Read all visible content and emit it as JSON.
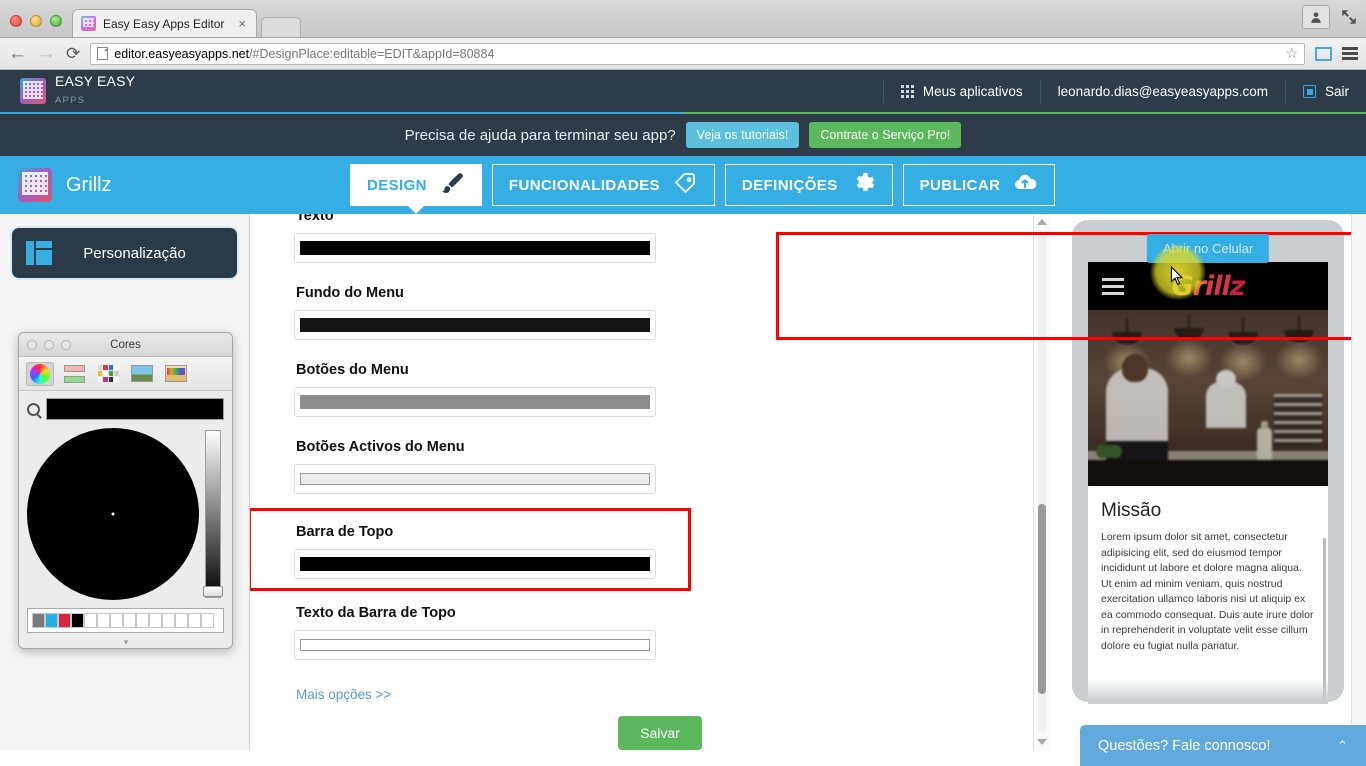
{
  "browser": {
    "tab_title": "Easy Easy Apps Editor",
    "tab_close": "×",
    "back_arrow": "←",
    "forward_arrow": "→",
    "reload": "⟳",
    "url_domain": "editor.easyeasyapps.net",
    "url_path": "/#DesignPlace:editable=EDIT&appId=80884",
    "star": "☆"
  },
  "app_header": {
    "brand_line1": "EASY EASY",
    "brand_line2": "APPS",
    "my_apps": "Meus aplicativos",
    "account_email": "leonardo.dias@easyeasyapps.com",
    "logout": "Sair"
  },
  "help_bar": {
    "text": "Precisa de ajuda para terminar seu app?",
    "tutorials_button": "Veja os tutoriais!",
    "pro_button": "Contrate o Serviço Pro!"
  },
  "app_nav": {
    "app_name": "Grillz",
    "tabs": [
      {
        "label": "DESIGN",
        "icon": "brush-icon",
        "active": true
      },
      {
        "label": "FUNCIONALIDADES",
        "icon": "tags-icon",
        "active": false
      },
      {
        "label": "DEFINIÇÕES",
        "icon": "gear-icon",
        "active": false
      },
      {
        "label": "PUBLICAR",
        "icon": "upload-cloud-icon",
        "active": false
      }
    ]
  },
  "sidebar": {
    "personalization_button": "Personalização"
  },
  "color_picker": {
    "title": "Cores",
    "tools": [
      "color-wheel-icon",
      "color-sliders-icon",
      "color-palettes-icon",
      "image-palette-icon",
      "crayons-icon"
    ],
    "selected_color": "#000000",
    "palette_swatches": [
      "#7a7a7a",
      "#21b0e0",
      "#d8253f",
      "#000000",
      "",
      "",
      "",
      "",
      "",
      "",
      "",
      "",
      "",
      "",
      ""
    ],
    "brightness_value": 0
  },
  "form": {
    "fields": [
      {
        "label": "Texto",
        "color": "#000000",
        "style": "solid"
      },
      {
        "label": "Fundo do Menu",
        "color": "#141414",
        "style": "solid"
      },
      {
        "label": "Botões do Menu",
        "color": "#8c8c8c",
        "style": "solid"
      },
      {
        "label": "Botões Activos do Menu",
        "color": "#ededed",
        "style": "outlined"
      },
      {
        "label": "Barra de Topo",
        "color": "#000000",
        "style": "solid"
      },
      {
        "label": "Texto da Barra de Topo",
        "color": "#ffffff",
        "style": "outlined"
      }
    ],
    "more_options": "Mais opções >>",
    "save_button": "Salvar",
    "highlighted_field": "Barra de Topo"
  },
  "preview": {
    "open_mobile_button": "Abrir no Celular",
    "phone_topbar_color": "#000000",
    "logo_text": "Grillz",
    "logo_letters": [
      {
        "char": "G",
        "color": "#e8a33d"
      },
      {
        "char": "r",
        "color": "#f05a28"
      },
      {
        "char": "i",
        "color": "#e03a4e"
      },
      {
        "char": "l",
        "color": "#d8324b"
      },
      {
        "char": "l",
        "color": "#d8324b"
      },
      {
        "char": "z",
        "color": "#c8203f"
      }
    ],
    "section_title": "Missão",
    "section_body": "Lorem ipsum dolor sit amet, consectetur adipisicing elit, sed do eiusmod tempor incididunt ut labore et dolore magna aliqua. Ut enim ad minim veniam, quis nostrud exercitation ullamco laboris nisi ut aliquip ex ea commodo consequat. Duis aute irure dolor in reprehenderit in voluptate velit esse cillum dolore eu fugiat nulla pariatur."
  },
  "chat": {
    "label": "Questões? Fale connosco!",
    "chevron": "⌃"
  },
  "colors": {
    "accent_blue": "#35afe3",
    "dark_navy": "#2e3c49",
    "green": "#5cb85c",
    "highlight_red": "#ff0000"
  }
}
